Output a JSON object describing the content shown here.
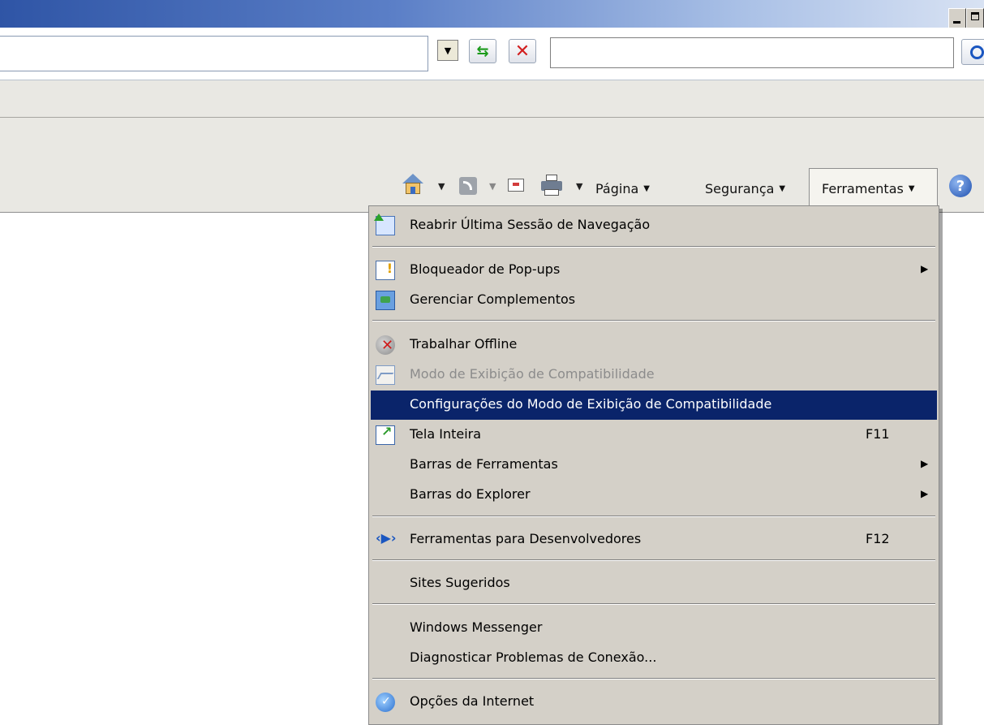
{
  "window": {
    "minimize_symbol": "",
    "maximize_symbol": ""
  },
  "address_bar": {
    "url_value": "",
    "search_value": ""
  },
  "command_bar": {
    "page_label": "Página",
    "security_label": "Segurança",
    "tools_label": "Ferramentas"
  },
  "tools_menu": {
    "items": [
      {
        "label": "Reabrir Última Sessão de Navegação",
        "icon": "reopen-session-icon"
      },
      {
        "label": "Bloqueador de Pop-ups",
        "icon": "popup-blocker-icon",
        "submenu": true
      },
      {
        "label": "Gerenciar Complementos",
        "icon": "manage-addons-icon"
      },
      {
        "label": "Trabalhar Offline",
        "icon": "work-offline-icon"
      },
      {
        "label": "Modo de Exibição de Compatibilidade",
        "icon": "compatibility-view-icon",
        "disabled": true
      },
      {
        "label": "Configurações do Modo de Exibição de Compatibilidade",
        "highlighted": true
      },
      {
        "label": "Tela Inteira",
        "icon": "fullscreen-icon",
        "shortcut": "F11"
      },
      {
        "label": "Barras de Ferramentas",
        "submenu": true
      },
      {
        "label": "Barras do Explorer",
        "submenu": true
      },
      {
        "label": "Ferramentas para Desenvolvedores",
        "icon": "developer-tools-icon",
        "shortcut": "F12"
      },
      {
        "label": "Sites Sugeridos"
      },
      {
        "label": "Windows Messenger"
      },
      {
        "label": "Diagnosticar Problemas de Conexão..."
      },
      {
        "label": "Opções da Internet",
        "icon": "internet-options-icon"
      }
    ]
  },
  "colors": {
    "highlight": "#0a246a",
    "menu_bg": "#d4d0c8",
    "toolbar_bg": "#e9e8e3"
  }
}
